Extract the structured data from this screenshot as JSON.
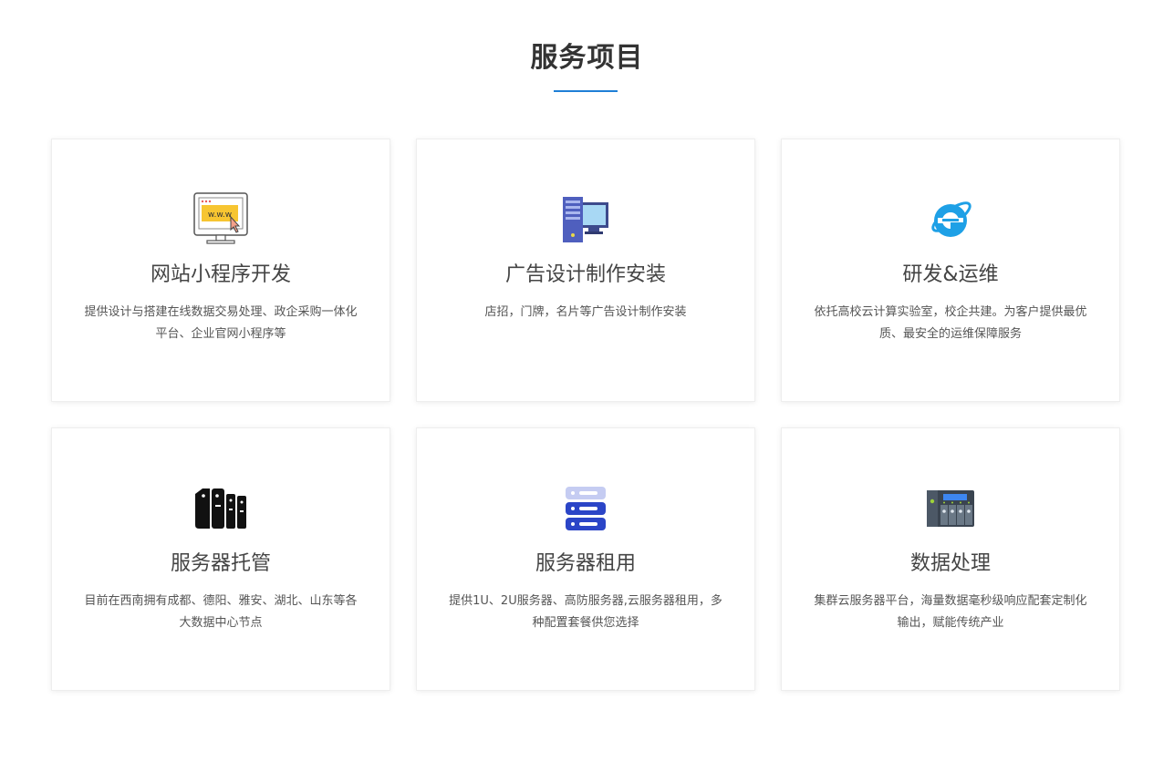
{
  "section": {
    "title": "服务项目"
  },
  "services": [
    {
      "title": "网站小程序开发",
      "description": "提供设计与搭建在线数据交易处理、政企采购一体化平台、企业官网小程序等",
      "icon": "www-monitor-icon"
    },
    {
      "title": "广告设计制作安装",
      "description": "店招，门牌，名片等广告设计制作安装",
      "icon": "desktop-computer-icon"
    },
    {
      "title": "研发&运维",
      "description": "依托高校云计算实验室，校企共建。为客户提供最优质、最安全的运维保障服务",
      "icon": "ie-browser-icon"
    },
    {
      "title": "服务器托管",
      "description": "目前在西南拥有成都、德阳、雅安、湖北、山东等各大数据中心节点",
      "icon": "server-racks-icon"
    },
    {
      "title": "服务器租用",
      "description": "提供1U、2U服务器、高防服务器,云服务器租用，多种配置套餐供您选择",
      "icon": "server-stack-icon"
    },
    {
      "title": "数据处理",
      "description": "集群云服务器平台，海量数据毫秒级响应配套定制化输出，赋能传统产业",
      "icon": "nas-storage-icon"
    }
  ],
  "colors": {
    "accent": "#1f7fd6",
    "title_text": "#333333",
    "desc_text": "#555555"
  }
}
